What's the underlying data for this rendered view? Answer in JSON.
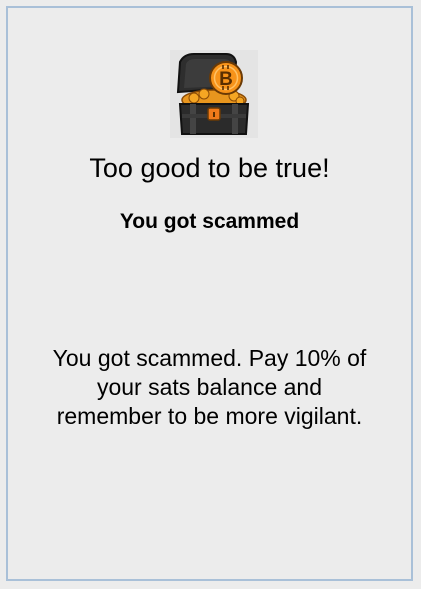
{
  "card": {
    "icon": "treasure-chest-bitcoin-icon",
    "title": "Too good to be true!",
    "subtitle": "You got scammed",
    "message": "You got scammed. Pay 10% of your sats balance and remember to be more vigilant."
  },
  "colors": {
    "background": "#ececec",
    "border": "#a9c0d8",
    "coin": "#f7931a",
    "chest": "#2b2b2b"
  }
}
